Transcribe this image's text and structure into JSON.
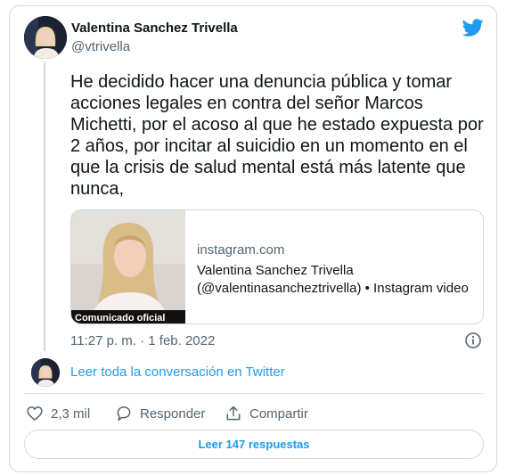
{
  "author": {
    "name": "Valentina Sanchez Trivella",
    "handle": "@vtrivella"
  },
  "tweet": {
    "text": "He decidido hacer una denuncia pública y tomar acciones legales en contra del señor Marcos Michetti, por el acoso al que he estado expuesta por 2 años, por incitar al suicidio en un momento en el que la crisis de salud mental está más latente que nunca,",
    "timestamp": "11:27 p. m. · 1 feb. 2022"
  },
  "link_card": {
    "domain": "instagram.com",
    "title": "Valentina Sanchez Trivella (@valentinasancheztrivella) • Instagram video",
    "thumbnail_caption": "Comunicado oficial"
  },
  "read_conversation_label": "Leer toda la conversación en Twitter",
  "actions": {
    "like_count": "2,3 mil",
    "reply_label": "Responder",
    "share_label": "Compartir"
  },
  "read_replies_label": "Leer 147 respuestas",
  "icons": {
    "brand": "twitter-bird-icon",
    "info": "info-icon",
    "like": "heart-icon",
    "reply": "reply-bubble-icon",
    "share": "share-icon"
  },
  "colors": {
    "accent": "#1d9bf0",
    "text": "#0f1419",
    "secondary": "#536471",
    "border": "#cfd9de"
  }
}
